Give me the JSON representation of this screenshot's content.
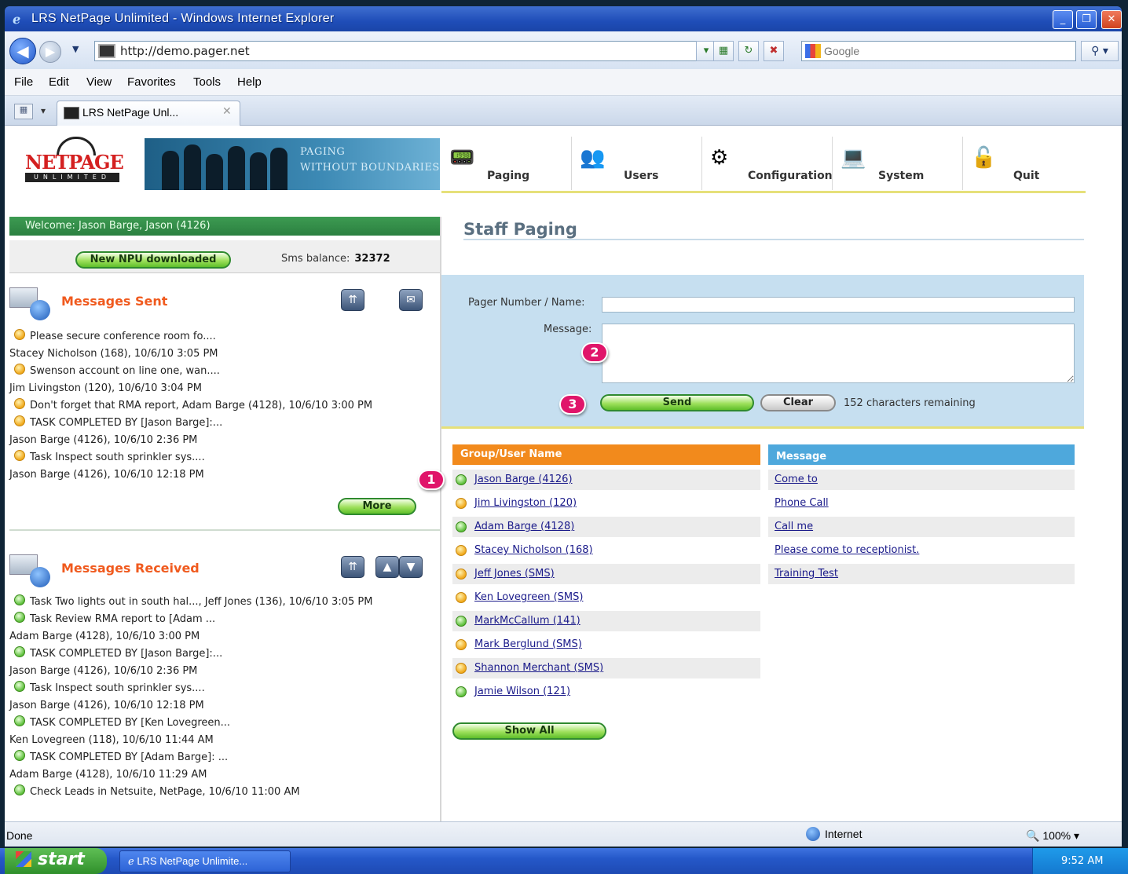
{
  "window": {
    "title": "LRS NetPage Unlimited - Windows Internet Explorer",
    "min": "_",
    "max": "❐",
    "close": "✕"
  },
  "addressbar": {
    "url": "http://demo.pager.net",
    "search_placeholder": "Google"
  },
  "menubar": [
    "File",
    "Edit",
    "View",
    "Favorites",
    "Tools",
    "Help"
  ],
  "tab": {
    "label": "LRS NetPage Unl...",
    "close": "✕"
  },
  "logo": {
    "word": "NETPAGE",
    "sub": "UNLIMITED"
  },
  "banner": {
    "line1": "PAGING",
    "line2": "WITHOUT BOUNDARIES"
  },
  "topnav": [
    {
      "label": "Paging",
      "icon": "pager-icon"
    },
    {
      "label": "Users",
      "icon": "users-icon"
    },
    {
      "label": "Configuration",
      "icon": "configuration-icon"
    },
    {
      "label": "System",
      "icon": "system-icon"
    },
    {
      "label": "Quit",
      "icon": "quit-icon"
    }
  ],
  "left": {
    "welcome": "Welcome: Jason Barge, Jason (4126)",
    "npu_button": "New NPU downloaded",
    "sms_label": "Sms balance:",
    "sms_value": "32372",
    "sent_title": "Messages Sent",
    "sent": [
      {
        "status": "yellow",
        "line1": "Please secure conference room fo....",
        "line2": "Stacey Nicholson (168), 10/6/10 3:05 PM"
      },
      {
        "status": "yellow",
        "line1": "Swenson account on line one, wan....",
        "line2": "Jim Livingston (120), 10/6/10 3:04 PM"
      },
      {
        "status": "yellow",
        "line1": "Don't forget that RMA report, Adam Barge (4128), 10/6/10 3:00 PM",
        "line2": ""
      },
      {
        "status": "yellow",
        "line1": "TASK COMPLETED BY [Jason Barge]:...",
        "line2": "Jason Barge (4126), 10/6/10 2:36 PM"
      },
      {
        "status": "yellow",
        "line1": "Task Inspect south sprinkler sys....",
        "line2": "Jason Barge (4126), 10/6/10 12:18 PM"
      }
    ],
    "more_button": "More",
    "received_title": "Messages Received",
    "received": [
      {
        "status": "green",
        "line1": "Task Two lights out in south hal..., Jeff Jones (136), 10/6/10 3:05 PM",
        "line2": ""
      },
      {
        "status": "green",
        "line1": "Task Review RMA report to [Adam ...",
        "line2": "Adam Barge (4128), 10/6/10 3:00 PM"
      },
      {
        "status": "green",
        "line1": "TASK COMPLETED BY [Jason Barge]:...",
        "line2": "Jason Barge (4126), 10/6/10 2:36 PM"
      },
      {
        "status": "green",
        "line1": "Task Inspect south sprinkler sys....",
        "line2": "Jason Barge (4126), 10/6/10 12:18 PM"
      },
      {
        "status": "green",
        "line1": "TASK COMPLETED BY [Ken Lovegreen...",
        "line2": "Ken Lovegreen (118), 10/6/10 11:44 AM"
      },
      {
        "status": "green",
        "line1": "TASK COMPLETED BY [Adam Barge]: ...",
        "line2": "Adam Barge (4128), 10/6/10 11:29 AM"
      },
      {
        "status": "green",
        "line1": "Check Leads in Netsuite, NetPage, 10/6/10 11:00 AM",
        "line2": ""
      }
    ]
  },
  "staff": {
    "title": "Staff Paging",
    "pager_label": "Pager Number / Name:",
    "message_label": "Message:",
    "send": "Send",
    "clear": "Clear",
    "remaining": "152 characters remaining",
    "group_header": "Group/User Name",
    "message_header": "Message",
    "users": [
      {
        "name": "Jason Barge (4126)",
        "status": "green"
      },
      {
        "name": "Jim Livingston (120)",
        "status": "yellow"
      },
      {
        "name": "Adam Barge (4128)",
        "status": "green"
      },
      {
        "name": "Stacey Nicholson (168)",
        "status": "yellow"
      },
      {
        "name": "Jeff Jones (SMS)",
        "status": "yellow"
      },
      {
        "name": "Ken Lovegreen (SMS)",
        "status": "yellow"
      },
      {
        "name": "MarkMcCallum (141)",
        "status": "green"
      },
      {
        "name": "Mark Berglund (SMS)",
        "status": "yellow"
      },
      {
        "name": "Shannon Merchant (SMS)",
        "status": "yellow"
      },
      {
        "name": "Jamie Wilson (121)",
        "status": "green"
      }
    ],
    "messages": [
      "Come to",
      "Phone Call",
      "Call me",
      "Please come to receptionist.",
      "Training Test"
    ],
    "show_all": "Show All",
    "callouts": [
      "1",
      "2",
      "3"
    ]
  },
  "statusbar": {
    "left": "Done",
    "zone": "Internet",
    "zoom": "100%"
  },
  "taskbar": {
    "start": "start",
    "item": "LRS NetPage Unlimite...",
    "clock": "9:52 AM"
  },
  "colors": {
    "accent_orange": "#f28a1c",
    "accent_blue": "#4ea8dc",
    "welcome_green": "#2b8040",
    "callout": "#e0156a"
  }
}
